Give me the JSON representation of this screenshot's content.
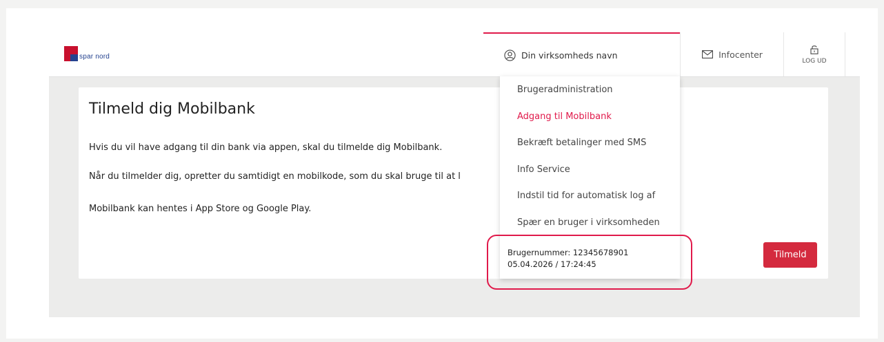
{
  "header": {
    "logo_text": "spar nord",
    "company_name": "Din virksomheds navn",
    "infocenter_label": "Infocenter",
    "logout_label": "LOG UD"
  },
  "main": {
    "title": "Tilmeld dig Mobilbank",
    "paragraphs": [
      "Hvis du vil have adgang til din bank via appen, skal du tilmelde dig Mobilbank.",
      "Når du tilmelder dig, opretter du samtidigt en mobilkode, som du skal bruge til at l",
      "Mobilbank kan hentes i App Store og Google Play."
    ],
    "submit_label": "Tilmeld"
  },
  "dropdown": {
    "items": [
      {
        "label": "Brugeradministration"
      },
      {
        "label": "Adgang til Mobilbank"
      },
      {
        "label": "Bekræft betalinger med SMS"
      },
      {
        "label": "Info Service"
      },
      {
        "label": "Indstil tid for automatisk log af"
      },
      {
        "label": "Spær en bruger i virksomheden"
      }
    ],
    "active_item": "Adgang til Mobilbank",
    "user_number": "Brugernummer: 12345678901",
    "timestamp": "05.04.2026 / 17:24:45"
  },
  "colors": {
    "accent": "#e0194a",
    "button": "#d42a3e",
    "brand_red": "#c8102e",
    "brand_blue": "#24428f",
    "background": "#ececeb"
  },
  "icons": {
    "user": "user-circle-icon",
    "mail": "mail-icon",
    "logout": "lock-icon"
  }
}
